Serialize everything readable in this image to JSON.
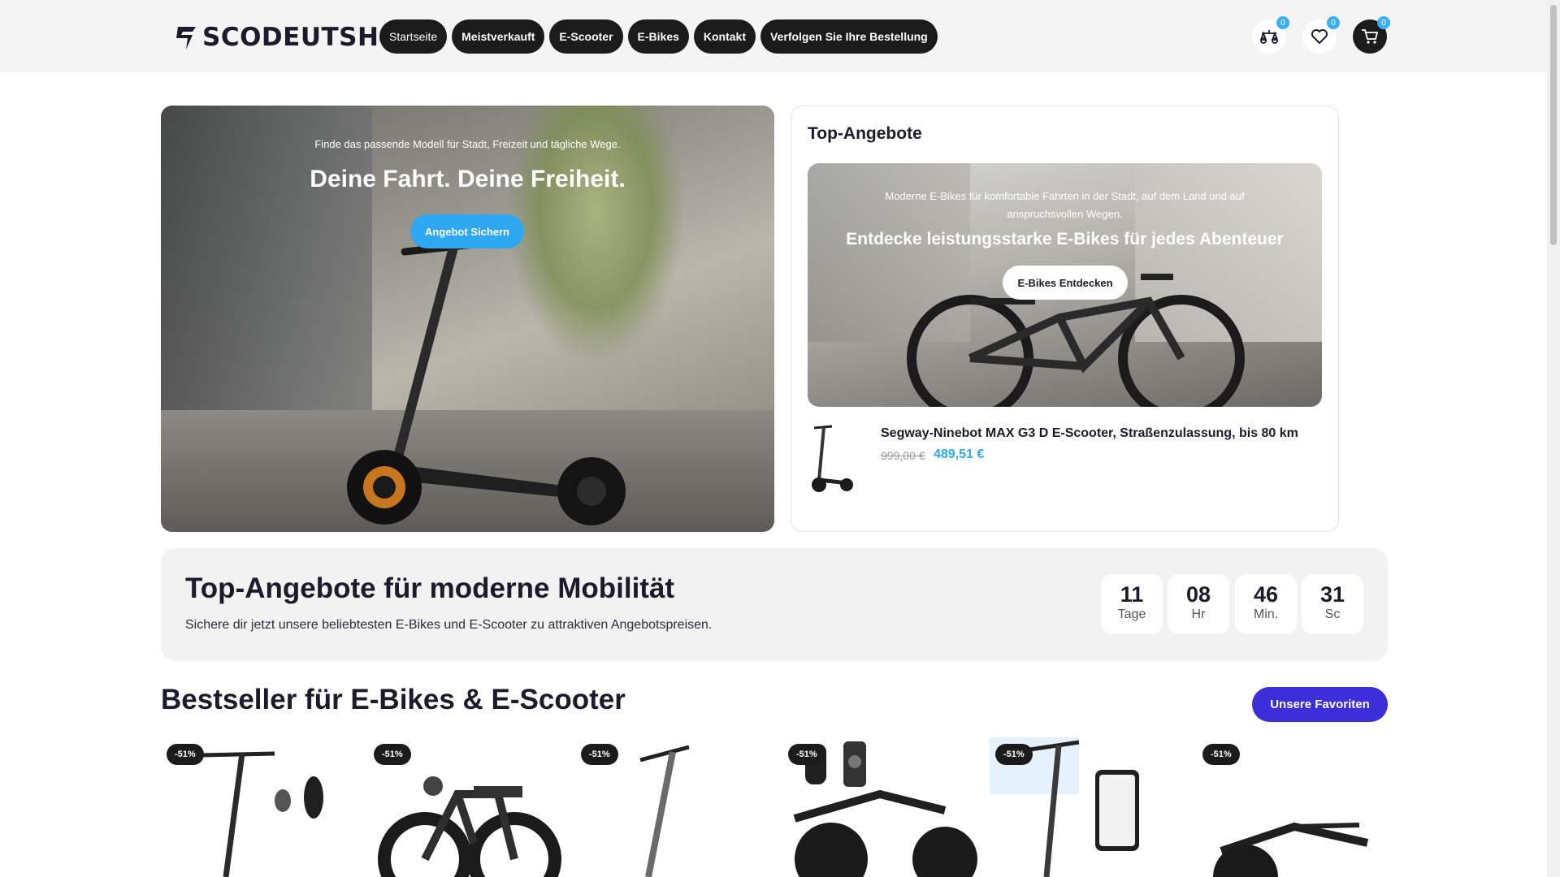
{
  "brand": {
    "logo_text": "SCODEUTSH"
  },
  "nav": {
    "items": [
      {
        "label": "Startseite"
      },
      {
        "label": "Meistverkauft"
      },
      {
        "label": "E-Scooter"
      },
      {
        "label": "E-Bikes"
      },
      {
        "label": "Kontakt"
      },
      {
        "label": "Verfolgen Sie Ihre Bestellung"
      }
    ]
  },
  "header_icons": {
    "compare": {
      "icon": "compare-icon",
      "count": "0"
    },
    "wishlist": {
      "icon": "heart-icon",
      "count": "0"
    },
    "cart": {
      "icon": "cart-icon",
      "count": "0"
    }
  },
  "hero": {
    "subtitle": "Finde das passende Modell für Stadt, Freizeit und tägliche Wege.",
    "title": "Deine Fahrt. Deine Freiheit.",
    "button": "Angebot Sichern"
  },
  "top_offers": {
    "title": "Top-Angebote",
    "banner": {
      "subtitle": "Moderne E-Bikes für komfortable Fahrten in der Stadt, auf dem Land und auf anspruchsvollen Wegen.",
      "title": "Entdecke leistungsstarke E-Bikes für jedes Abenteuer",
      "button": "E-Bikes Entdecken"
    },
    "product": {
      "name": "Segway-Ninebot MAX G3 D E-Scooter, Straßenzulassung, bis 80 km",
      "old_price": "999,00 €",
      "new_price": "489,51 €"
    }
  },
  "deal": {
    "title": "Top-Angebote für moderne Mobilität",
    "subtitle": "Sichere dir jetzt unsere beliebtesten E-Bikes und E-Scooter zu attraktiven Angebotspreisen.",
    "countdown": [
      {
        "value": "11",
        "label": "Tage"
      },
      {
        "value": "08",
        "label": "Hr"
      },
      {
        "value": "46",
        "label": "Min."
      },
      {
        "value": "31",
        "label": "Sc"
      }
    ]
  },
  "bestseller": {
    "title": "Bestseller für E-Bikes & E-Scooter",
    "button": "Unsere Favoriten",
    "products": [
      {
        "discount": "-51%"
      },
      {
        "discount": "-51%"
      },
      {
        "discount": "-51%"
      },
      {
        "discount": "-51%"
      },
      {
        "discount": "-51%"
      },
      {
        "discount": "-51%"
      }
    ]
  },
  "colors": {
    "accent_blue": "#2ea8f0",
    "accent_purple": "#3a2fd8",
    "dark": "#1b1b1b"
  }
}
